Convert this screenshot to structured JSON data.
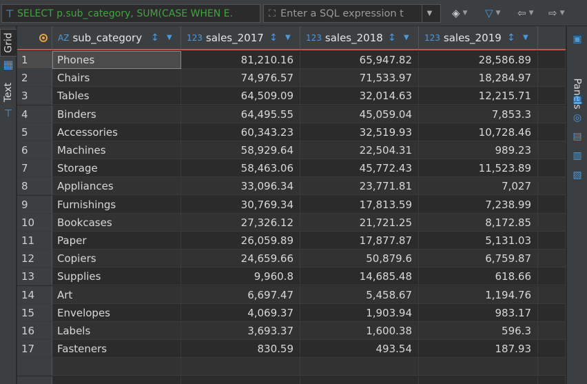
{
  "toolbar": {
    "sql_text": "SELECT p.sub_category, SUM(CASE WHEN E.",
    "filter_placeholder": "Enter a SQL expression t"
  },
  "left_tabs": [
    "Grid",
    "Text"
  ],
  "right_panel": {
    "label": "Panels"
  },
  "columns": [
    {
      "type": "AZ",
      "name": "sub_category"
    },
    {
      "type": "123",
      "name": "sales_2017"
    },
    {
      "type": "123",
      "name": "sales_2018"
    },
    {
      "type": "123",
      "name": "sales_2019"
    }
  ],
  "rows": [
    {
      "n": "1",
      "cat": "Phones",
      "s2017": "81,210.16",
      "s2018": "65,947.82",
      "s2019": "28,586.89"
    },
    {
      "n": "2",
      "cat": "Chairs",
      "s2017": "74,976.57",
      "s2018": "71,533.97",
      "s2019": "18,284.97"
    },
    {
      "n": "3",
      "cat": "Tables",
      "s2017": "64,509.09",
      "s2018": "32,014.63",
      "s2019": "12,215.71"
    },
    {
      "n": "4",
      "cat": "Binders",
      "s2017": "64,495.55",
      "s2018": "45,059.04",
      "s2019": "7,853.3"
    },
    {
      "n": "5",
      "cat": "Accessories",
      "s2017": "60,343.23",
      "s2018": "32,519.93",
      "s2019": "10,728.46"
    },
    {
      "n": "6",
      "cat": "Machines",
      "s2017": "58,929.64",
      "s2018": "22,504.31",
      "s2019": "989.23"
    },
    {
      "n": "7",
      "cat": "Storage",
      "s2017": "58,463.06",
      "s2018": "45,772.43",
      "s2019": "11,523.89"
    },
    {
      "n": "8",
      "cat": "Appliances",
      "s2017": "33,096.34",
      "s2018": "23,771.81",
      "s2019": "7,027"
    },
    {
      "n": "9",
      "cat": "Furnishings",
      "s2017": "30,769.34",
      "s2018": "17,813.59",
      "s2019": "7,238.99"
    },
    {
      "n": "10",
      "cat": "Bookcases",
      "s2017": "27,326.12",
      "s2018": "21,721.25",
      "s2019": "8,172.85"
    },
    {
      "n": "11",
      "cat": "Paper",
      "s2017": "26,059.89",
      "s2018": "17,877.87",
      "s2019": "5,131.03"
    },
    {
      "n": "12",
      "cat": "Copiers",
      "s2017": "24,659.66",
      "s2018": "50,879.6",
      "s2019": "6,759.87"
    },
    {
      "n": "13",
      "cat": "Supplies",
      "s2017": "9,960.8",
      "s2018": "14,685.48",
      "s2019": "618.66"
    },
    {
      "n": "14",
      "cat": "Art",
      "s2017": "6,697.47",
      "s2018": "5,458.67",
      "s2019": "1,194.76"
    },
    {
      "n": "15",
      "cat": "Envelopes",
      "s2017": "4,069.37",
      "s2018": "1,903.94",
      "s2019": "983.17"
    },
    {
      "n": "16",
      "cat": "Labels",
      "s2017": "3,693.37",
      "s2018": "1,600.38",
      "s2019": "596.3"
    },
    {
      "n": "17",
      "cat": "Fasteners",
      "s2017": "830.59",
      "s2018": "493.54",
      "s2019": "187.93"
    }
  ],
  "selected_row": "1",
  "icons": {
    "sql": "sql-expression-icon",
    "filter_clear": "eraser-icon",
    "filter": "funnel-icon",
    "back": "arrow-left-icon",
    "forward": "arrow-right-icon",
    "grid": "grid-view-icon",
    "text": "text-view-icon"
  },
  "colors": {
    "sql_text": "#3fa63f",
    "accent": "#4a9ae0",
    "header_underline": "#c75450",
    "marker": "#e8a33b"
  }
}
